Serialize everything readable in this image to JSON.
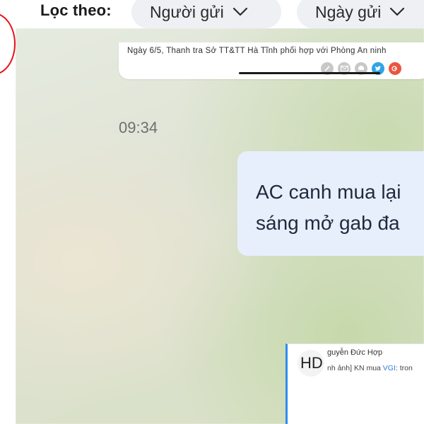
{
  "filter": {
    "label": "Lọc theo:",
    "sender_label": "Người gửi",
    "date_label": "Ngày gửi"
  },
  "link_preview": {
    "text": "Ngày 6/5, Thanh tra Sở TT&TT Hà Tĩnh phối hợp với Phòng An ninh",
    "share_icons": [
      "link-icon",
      "mail-icon",
      "print-icon",
      "twitter-icon",
      "google-plus-icon"
    ]
  },
  "timestamp": "09:34",
  "message": {
    "line1": "AC canh mua lại",
    "line2": "sáng mở gab đa"
  },
  "file_card": {
    "avatar_text": "HD",
    "sender": "guyễn Đức Hợp",
    "preview_prefix": "nh ảnh] KN mua ",
    "preview_keyword": "VGI",
    "preview_suffix": ": tron"
  },
  "colors": {
    "bubble": "#e7effd",
    "accent": "#2d8cf0",
    "annotation": "#e8121a"
  }
}
